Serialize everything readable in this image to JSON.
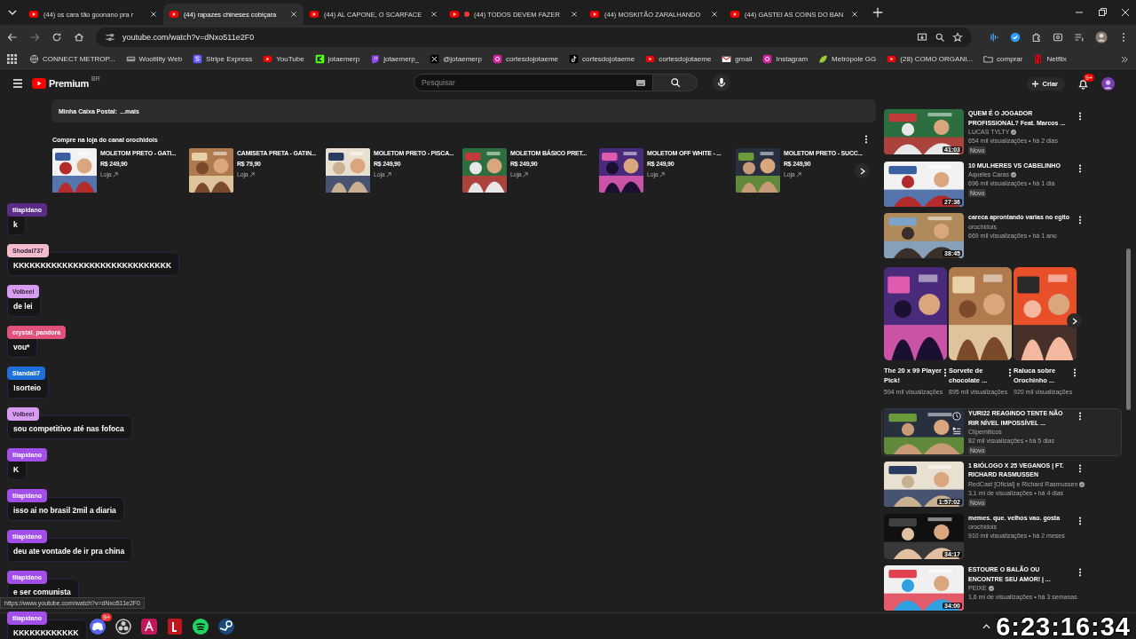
{
  "browser": {
    "tabs": [
      {
        "title": "(44) os cara tão goonano pra r",
        "live": false,
        "selected": false
      },
      {
        "title": "(44) rapazes chineses cobiçara",
        "live": false,
        "selected": true
      },
      {
        "title": "(44) AL CAPONE, O SCARFACE",
        "live": false,
        "selected": false
      },
      {
        "title": "(44) TODOS DEVEM FAZER",
        "live": true,
        "selected": false
      },
      {
        "title": "(44) MOSKITÃO ZARALHANDO",
        "live": false,
        "selected": false
      },
      {
        "title": "(44) GASTEI AS COINS DO BAN",
        "live": false,
        "selected": false
      }
    ],
    "url": "youtube.com/watch?v=dNxo511e2F0",
    "bookmarks": [
      {
        "label": "CONNECT METROP...",
        "kind": "globe"
      },
      {
        "label": "Wootility Web",
        "kind": "keyboard"
      },
      {
        "label": "Stripe Express",
        "kind": "stripe"
      },
      {
        "label": "YouTube",
        "kind": "youtube"
      },
      {
        "label": "jotaemerp",
        "kind": "kick"
      },
      {
        "label": "jotaemerp_",
        "kind": "twitch"
      },
      {
        "label": "@jotaemerp",
        "kind": "x"
      },
      {
        "label": "cortesdojotaeme",
        "kind": "instagram"
      },
      {
        "label": "cortesdojotaeme",
        "kind": "tiktok"
      },
      {
        "label": "cortesdojotaeme",
        "kind": "youtube"
      },
      {
        "label": "gmail",
        "kind": "gmail"
      },
      {
        "label": "Instagram",
        "kind": "instagram"
      },
      {
        "label": "Metrópole GG",
        "kind": "leaf"
      },
      {
        "label": "(28) COMO ORGANI...",
        "kind": "youtube"
      },
      {
        "label": "comprar",
        "kind": "folder"
      },
      {
        "label": "Netflix",
        "kind": "netflix"
      }
    ]
  },
  "youtube": {
    "logo": "Premium",
    "region": "BR",
    "search": {
      "placeholder": "Pesquisar"
    },
    "create": "Criar",
    "notifications": "9+",
    "description": {
      "label": "Minha Caixa Postal:",
      "more": "...mais"
    },
    "shop": {
      "title": "Compre na loja do canal orochidois",
      "products": [
        {
          "name": "MOLETOM PRETO - GATI...",
          "price": "R$ 249,90",
          "store": "Loja"
        },
        {
          "name": "CAMISETA PRETA - GATIN...",
          "price": "R$ 79,90",
          "store": "Loja"
        },
        {
          "name": "MOLETOM PRETO - PISCA...",
          "price": "R$ 249,90",
          "store": "Loja"
        },
        {
          "name": "MOLETOM BÁSICO PRET...",
          "price": "R$ 249,90",
          "store": "Loja"
        },
        {
          "name": "MOLETOM OFF WHITE - ...",
          "price": "R$ 249,90",
          "store": "Loja"
        },
        {
          "name": "MOLETOM PRETO - SUCC...",
          "price": "R$ 249,90",
          "store": "Loja"
        }
      ]
    },
    "chat": [
      {
        "user": "tilapidano",
        "color": "#5b2d86",
        "text": "k"
      },
      {
        "user": "Shodai737",
        "color": "#f2bccb",
        "text": "KKKKKKKKKKKKKKKKKKKKKKKKKKKKK"
      },
      {
        "user": "Volbeei",
        "color": "#d59cf0",
        "text": "de lei"
      },
      {
        "user": "crystal_pandora",
        "color": "#e0527c",
        "text": "vou*"
      },
      {
        "user": "Standali7",
        "color": "#1f6fd8",
        "text": "!sorteio"
      },
      {
        "user": "Volbeei",
        "color": "#d59cf0",
        "text": "sou competitivo até nas fofoca"
      },
      {
        "user": "tilapidano",
        "color": "#a24ee8",
        "text": "K"
      },
      {
        "user": "tilapidano",
        "color": "#a24ee8",
        "text": "isso ai no brasil 2mil a diaria"
      },
      {
        "user": "tilapidano",
        "color": "#a24ee8",
        "text": "deu ate vontade de ir pra china"
      },
      {
        "user": "tilapidano",
        "color": "#a24ee8",
        "text": "e ser comunista"
      },
      {
        "user": "tilapidano",
        "color": "#a24ee8",
        "text": "KKKKKKKKKKKK"
      }
    ],
    "related": [
      {
        "kind": "video",
        "title": "QUEM É O JOGADOR PROFISSIONAL? Feat. Marcos ...",
        "channel": "LUCAS TYLTY",
        "verified": true,
        "stats": "654 mil visualizações • há 2 dias",
        "badge": "Novo",
        "duration": "41:03",
        "hovered": false
      },
      {
        "kind": "video",
        "title": "10 MULHERES VS CABELINHO",
        "channel": "Aqueles Caras",
        "verified": true,
        "stats": "696 mil visualizações • há 1 dia",
        "badge": "Novo",
        "duration": "27:36",
        "hovered": false
      },
      {
        "kind": "video",
        "title": "careca aprontando varias no egito",
        "channel": "orochidois",
        "verified": false,
        "stats": "669 mil visualizações • há 1 ano",
        "duration": "38:45",
        "hovered": false
      },
      {
        "kind": "shorts",
        "items": [
          {
            "title": "The 20 x 99 Player Pick!",
            "views": "594 mil visualizações"
          },
          {
            "title": "Sorvete de chocolate ...",
            "views": "895 mil visualizações"
          },
          {
            "title": "Raluca sobre Orochinho ...",
            "views": "920 mil visualizações"
          }
        ]
      },
      {
        "kind": "video",
        "title": "YURI22 REAGINDO TENTE NÃO RIR NÍVEL IMPOSSÍVEL ...",
        "channel": "Clipemiticos",
        "verified": false,
        "stats": "82 mil visualizações • há 5 dias",
        "badge": "Novo",
        "hovered": true
      },
      {
        "kind": "video",
        "title": "1 BIÓLOGO X 25 VEGANOS | FT. RICHARD RASMUSSEN",
        "channel": "RedCast [Oficial] e Richard Rasmussen",
        "verified": true,
        "stats": "3,1 mi de visualizações • há 4 dias",
        "badge": "Novo",
        "duration": "1:57:02",
        "hovered": false
      },
      {
        "kind": "video",
        "title": "memes. que. velhos vao. gosta",
        "channel": "orochidois",
        "verified": false,
        "stats": "910 mil visualizações • há 2 meses",
        "duration": "34:17",
        "hovered": false
      },
      {
        "kind": "video",
        "title": "ESTOURE O BALÃO OU ENCONTRE SEU AMOR! | ...",
        "channel": "PEIXE",
        "verified": true,
        "stats": "1,6 mi de visualizações • há 3 semanas",
        "duration": "34:00",
        "hovered": false
      }
    ],
    "status_url": "https://www.youtube.com/watch?v=dNxo511e2F0"
  },
  "taskbar": {
    "apps": [
      {
        "kind": "discord",
        "badge": "9+"
      },
      {
        "kind": "obs"
      },
      {
        "kind": "affinity"
      },
      {
        "kind": "red-app"
      },
      {
        "kind": "spotify"
      },
      {
        "kind": "steam"
      }
    ],
    "timer": "6:23:16:34"
  }
}
